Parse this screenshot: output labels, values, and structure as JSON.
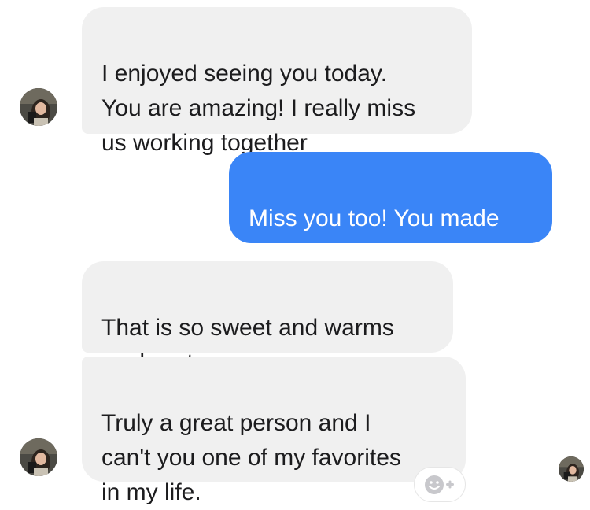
{
  "conversation": {
    "messages": [
      {
        "sender": "contact",
        "text": "I enjoyed seeing you today.\nYou are amazing! I really miss\nus working together"
      },
      {
        "sender": "me",
        "text": "Miss you too! You made\nworking more fun"
      },
      {
        "sender": "contact",
        "text": "That is so sweet and warms\nmy heart."
      },
      {
        "sender": "contact",
        "text": "Truly a great person and I\ncan't you one of my favorites\nin my life."
      }
    ]
  },
  "reaction_button": {
    "icon": "add-reaction-icon"
  },
  "colors": {
    "incoming_bubble": "#f0f0f0",
    "outgoing_bubble": "#3a85f7",
    "outgoing_text": "#ffffff",
    "incoming_text": "#1c1c1e",
    "reaction_icon": "#c8c8cc"
  }
}
